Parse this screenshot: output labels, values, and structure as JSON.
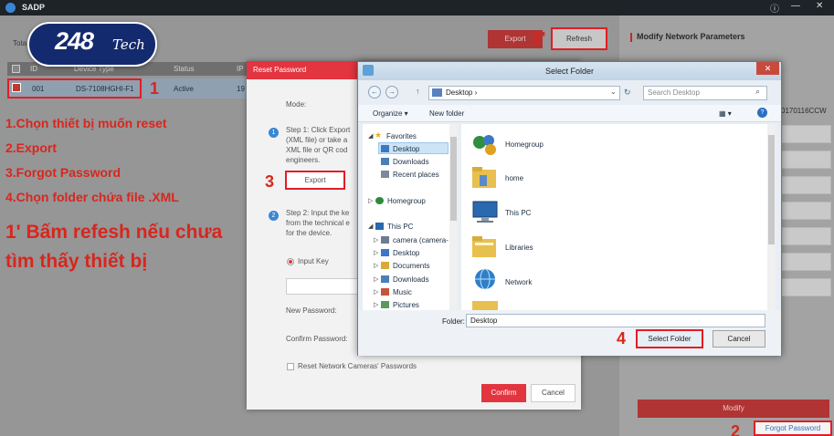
{
  "titlebar": {
    "app": "SADP",
    "info": "ⓘ",
    "minimize": "—",
    "close": "✕"
  },
  "badge": {
    "num": "248",
    "tech": "Tech"
  },
  "main": {
    "total": "Tota",
    "export": "Export",
    "refresh": "Refresh",
    "headers": [
      "ID",
      "Device Type",
      "Status",
      "IP"
    ],
    "row": {
      "id": "001",
      "type": "DS-7108HGHI-F1",
      "status": "Active",
      "ip": "19"
    }
  },
  "annotations": {
    "steps": [
      "1.Chọn thiết bị muốn reset",
      "2.Export",
      "3.Forgot Password",
      "4.Chọn folder chứa file .XML"
    ],
    "tip": [
      "1' Bấm refesh nếu chưa",
      "tìm thấy thiết bị"
    ],
    "n1": "1",
    "n1p": "1'",
    "n2": "2",
    "n3": "3",
    "n4": "4"
  },
  "right_panel": {
    "title": "Modify Network Parameters",
    "serial": "0170116CCW",
    "modify": "Modify",
    "forgot": "Forgot Password"
  },
  "reset": {
    "title": "Reset Password",
    "mode": "Mode:",
    "s1num": "1",
    "step1": [
      "Step 1: Click Export",
      "(XML file) or take a",
      "XML file or QR cod",
      "engineers."
    ],
    "export": "Export",
    "s2num": "2",
    "step2": [
      "Step 2: Input the ke",
      "from the technical e",
      "for the device."
    ],
    "input_key": "Input Key",
    "new_pw": "New Password:",
    "confirm_pw": "Confirm Password:",
    "reset_cams": "Reset Network Cameras' Passwords",
    "confirm": "Confirm",
    "cancel": "Cancel"
  },
  "select_folder": {
    "title": "Select Folder",
    "close": "✕",
    "back": "←",
    "forward": "→",
    "up": "↑",
    "address": "Desktop  ›",
    "address_chevron": "⌄",
    "refresh": "↻",
    "search_placeholder": "Search Desktop",
    "search_icon": "⌕",
    "organize": "Organize ▾",
    "new_folder": "New folder",
    "view": "▦ ▾",
    "help": "?",
    "nav": {
      "favorites": "Favorites",
      "desktop": "Desktop",
      "downloads": "Downloads",
      "recent": "Recent places",
      "homegroup": "Homegroup",
      "thispc": "This PC",
      "pc_items": [
        "camera (camera-",
        "Desktop",
        "Documents",
        "Downloads",
        "Music",
        "Pictures"
      ]
    },
    "items": [
      "Homegroup",
      "home",
      "This PC",
      "Libraries",
      "Network"
    ],
    "folder_label": "Folder:",
    "folder_value": "Desktop",
    "select": "Select Folder",
    "cancel": "Cancel"
  }
}
